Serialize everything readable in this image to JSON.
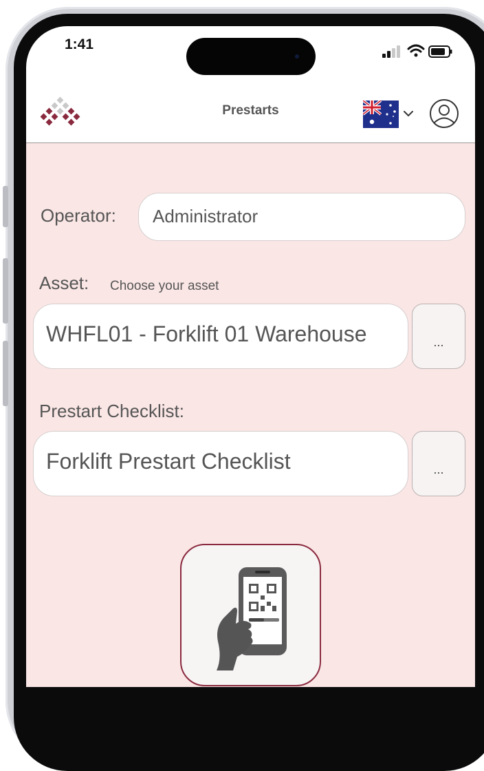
{
  "status_bar": {
    "time": "1:41"
  },
  "header": {
    "title": "Prestarts",
    "language_flag": "australia-flag-icon",
    "icons": [
      "company-logo",
      "chevron-down-icon",
      "user-profile-icon"
    ]
  },
  "form": {
    "operator_label": "Operator:",
    "operator_value": "Administrator",
    "asset_label": "Asset:",
    "asset_hint": "Choose your asset",
    "asset_value": "WHFL01 - Forklift 01 Warehouse",
    "asset_picker_label": "...",
    "checklist_label": "Prestart Checklist:",
    "checklist_value": "Forklift Prestart Checklist",
    "checklist_picker_label": "...",
    "scan_button_icon": "qr-code-scan-icon"
  },
  "colors": {
    "background": "#fae6e5",
    "brand": "#8a2a3e",
    "text": "#555555"
  }
}
